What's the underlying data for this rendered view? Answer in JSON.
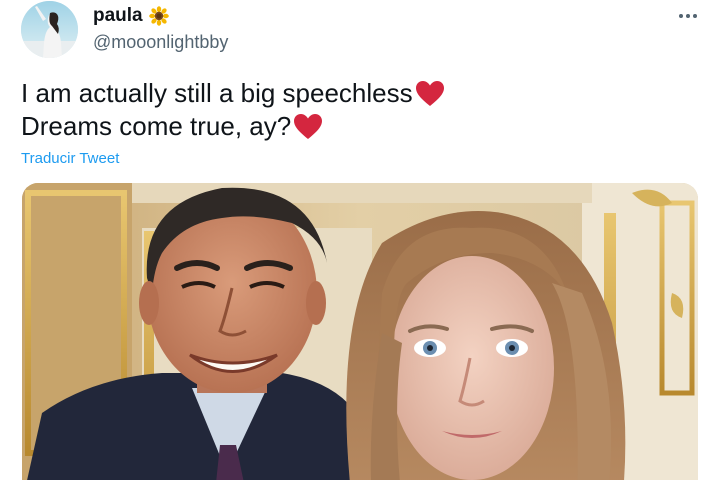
{
  "user": {
    "display_name": "paula",
    "handle": "@mooonlightbby",
    "name_emoji": "sunflower-icon"
  },
  "tweet": {
    "lines": [
      "I am actually still a big speechless",
      "Dreams come true, ay?"
    ],
    "line_emoji": "heart-icon",
    "translate_label": "Traducir Tweet"
  },
  "menu": {
    "icon": "more-icon"
  },
  "colors": {
    "link": "#1d9bf0",
    "handle": "#536471",
    "text": "#0f1419",
    "heart": "#d4263f"
  }
}
